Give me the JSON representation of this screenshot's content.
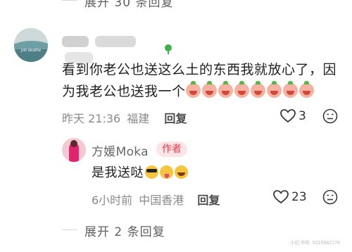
{
  "top_expand": {
    "label": "展开 30 条回复"
  },
  "comment": {
    "author": "",
    "text": "看到你老公也送这么土的东西我就放心了，因为我老公也送我一个",
    "emoji_count": 8,
    "emoji_icon": "crying-peach-emoji",
    "time": "昨天 21:36",
    "location": "福建",
    "reply_label": "回复",
    "likes": "3",
    "avatar_caption": "job deathe"
  },
  "reply": {
    "author": "方媛Moka",
    "badge": "作者",
    "text": "是我送哒",
    "emojis": [
      "sunglasses-emoji",
      "tongue-out-emoji",
      "laughing-emoji"
    ],
    "time": "6小时前",
    "location": "中国香港",
    "reply_label": "回复",
    "likes": "23"
  },
  "bottom_expand": {
    "label": "展开 2 条回复"
  },
  "watermark": "小红书号: 5216882178"
}
